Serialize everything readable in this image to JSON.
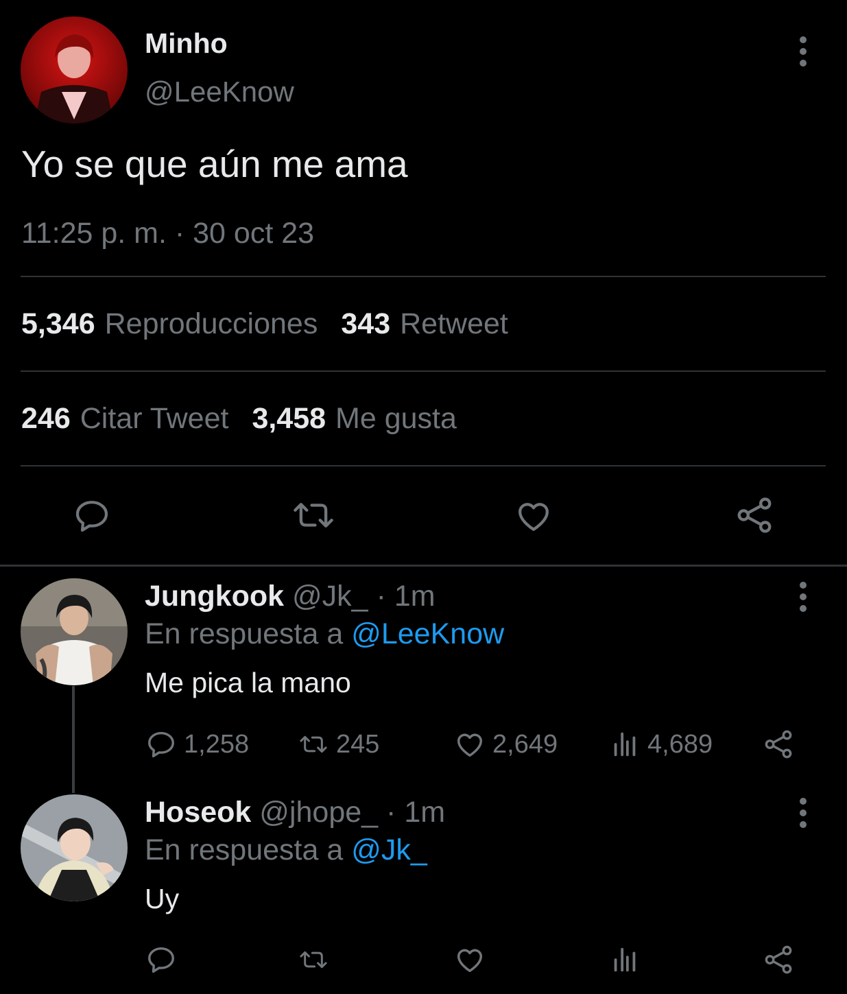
{
  "main_tweet": {
    "name": "Minho",
    "handle": "@LeeKnow",
    "text": "Yo se que aún me ama",
    "timestamp": "11:25 p. m. · 30 oct 23",
    "stats": {
      "views_count": "5,346",
      "views_label": "Reproducciones",
      "retweets_count": "343",
      "retweets_label": "Retweet",
      "quotes_count": "246",
      "quotes_label": "Citar Tweet",
      "likes_count": "3,458",
      "likes_label": "Me gusta"
    },
    "actions": [
      "reply-icon",
      "retweet-icon",
      "heart-icon",
      "share-icon"
    ]
  },
  "replies": [
    {
      "name": "Jungkook",
      "handle": "@Jk_",
      "dot": "·",
      "time": "1m",
      "reply_prefix": "En respuesta a",
      "reply_to": "@LeeKnow",
      "text": "Me pica la mano",
      "counts": {
        "replies": "1,258",
        "retweets": "245",
        "likes": "2,649",
        "views": "4,689"
      }
    },
    {
      "name": "Hoseok",
      "handle": "@jhope_",
      "dot": "·",
      "time": "1m",
      "reply_prefix": "En respuesta a",
      "reply_to": "@Jk_",
      "text": "Uy",
      "counts": {
        "replies": "",
        "retweets": "",
        "likes": "",
        "views": ""
      }
    }
  ],
  "colors": {
    "background": "#000000",
    "text_primary": "#e7e9ea",
    "text_secondary": "#71767b",
    "link": "#1d9bf0",
    "divider": "#2f3336"
  }
}
